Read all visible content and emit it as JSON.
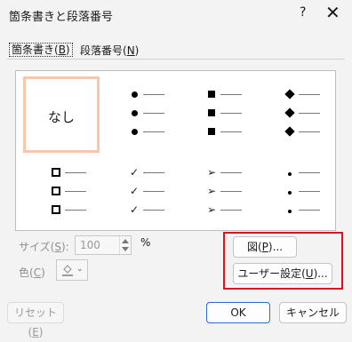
{
  "window": {
    "title": "箇条書きと段落番号",
    "help": "?",
    "close": "✕"
  },
  "tabs": [
    {
      "label": "箇条書き(",
      "key": "B",
      "suffix": ")"
    },
    {
      "label": "段落番号(",
      "key": "N",
      "suffix": ")"
    }
  ],
  "gallery": {
    "none_label": "なし",
    "styles": [
      {
        "icon": "filled-circle"
      },
      {
        "icon": "filled-square"
      },
      {
        "icon": "filled-diamond"
      },
      {
        "icon": "hollow-square"
      },
      {
        "icon": "check-mark"
      },
      {
        "icon": "arrowhead"
      },
      {
        "icon": "small-dot"
      }
    ]
  },
  "size": {
    "label": "サイズ(",
    "key": "S",
    "suffix": "):",
    "value": "100",
    "unit": "%"
  },
  "color": {
    "label": "色(",
    "key": "C",
    "suffix": ")"
  },
  "buttons": {
    "picture": {
      "label": "図(",
      "key": "P",
      "suffix": ")..."
    },
    "user": {
      "label": "ユーザー設定(",
      "key": "U",
      "suffix": ")..."
    },
    "reset": {
      "label": "リセット(",
      "key": "E",
      "suffix": ")"
    },
    "ok": "OK",
    "cancel": "キャンセル"
  },
  "colors": {
    "highlight_box": "#e0101e",
    "selection": "#f7c7a8",
    "ok_border": "#2b6ad1"
  }
}
